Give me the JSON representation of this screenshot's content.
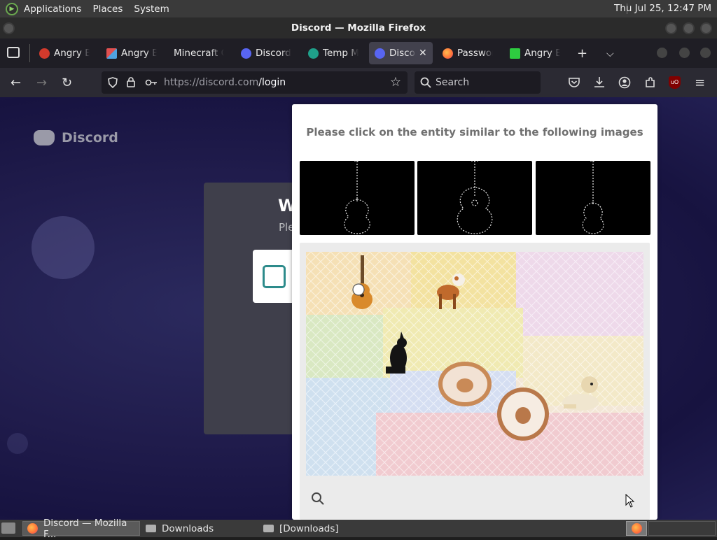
{
  "desktop": {
    "menu": [
      "Applications",
      "Places",
      "System"
    ],
    "clock": "Thu Jul 25, 12:47 PM"
  },
  "window": {
    "title": "Discord — Mozilla Firefox"
  },
  "tabs": [
    {
      "label": "Angry Birds",
      "favicon_color": "#d33a2c"
    },
    {
      "label": "Angry Birds",
      "favicon_color": "#e05050"
    },
    {
      "label": "Minecraft Classic",
      "favicon_color": ""
    },
    {
      "label": "Discord",
      "favicon_color": "#5865f2"
    },
    {
      "label": "Temp Mail",
      "favicon_color": "#1fa08a"
    },
    {
      "label": "Discord",
      "favicon_color": "#5865f2",
      "active": true
    },
    {
      "label": "Password",
      "favicon_color": "#ff7139"
    },
    {
      "label": "Angry Birds",
      "favicon_color": "#2ecc40"
    }
  ],
  "nav": {
    "url_host": "https://discord.com",
    "url_path": "/login",
    "search_placeholder": "Search"
  },
  "page": {
    "brand": "Discord",
    "login_heading": "W",
    "login_sub": "Ple"
  },
  "captcha": {
    "prompt": "Please click on the entity similar to the following images",
    "examples": [
      "guitar",
      "guitar",
      "guitar"
    ],
    "task_objects": [
      "guitar",
      "dog",
      "dog",
      "donut",
      "donut",
      "dog"
    ]
  },
  "taskbar": {
    "items": [
      "Discord — Mozilla F...",
      "Downloads",
      "[Downloads]"
    ]
  },
  "colors": {
    "accent": "#5865f2",
    "firefox_dark": "#2b2a33"
  }
}
